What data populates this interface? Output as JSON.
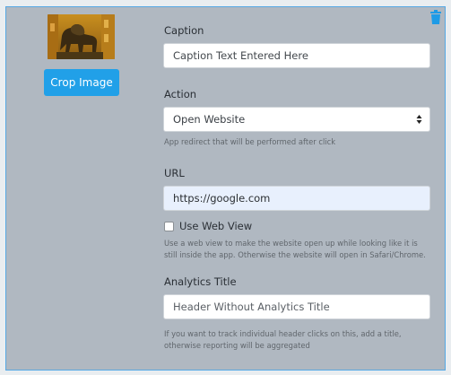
{
  "image_tile": {
    "crop_button_label": "Crop Image",
    "delete_icon": "trash-icon"
  },
  "form": {
    "caption": {
      "label": "Caption",
      "value": "Caption Text Entered Here"
    },
    "action": {
      "label": "Action",
      "selected": "Open Website",
      "help": "App redirect that will be performed after click"
    },
    "url": {
      "label": "URL",
      "value": "https://google.com"
    },
    "web_view": {
      "label": "Use Web View",
      "checked": false,
      "help": "Use a web view to make the website open up while looking like it is still inside the app. Otherwise the website will open in Safari/Chrome."
    },
    "analytics_title": {
      "label": "Analytics Title",
      "placeholder": "Header Without Analytics Title",
      "help": "If you want to track individual header clicks on this, add a title, otherwise reporting will be aggregated"
    }
  },
  "colors": {
    "panel_bg": "#b0b8c1",
    "panel_border": "#55a8e4",
    "accent": "#21a0e8",
    "delete_icon": "#1e9be6",
    "url_field_bg": "#e8f0fd"
  }
}
